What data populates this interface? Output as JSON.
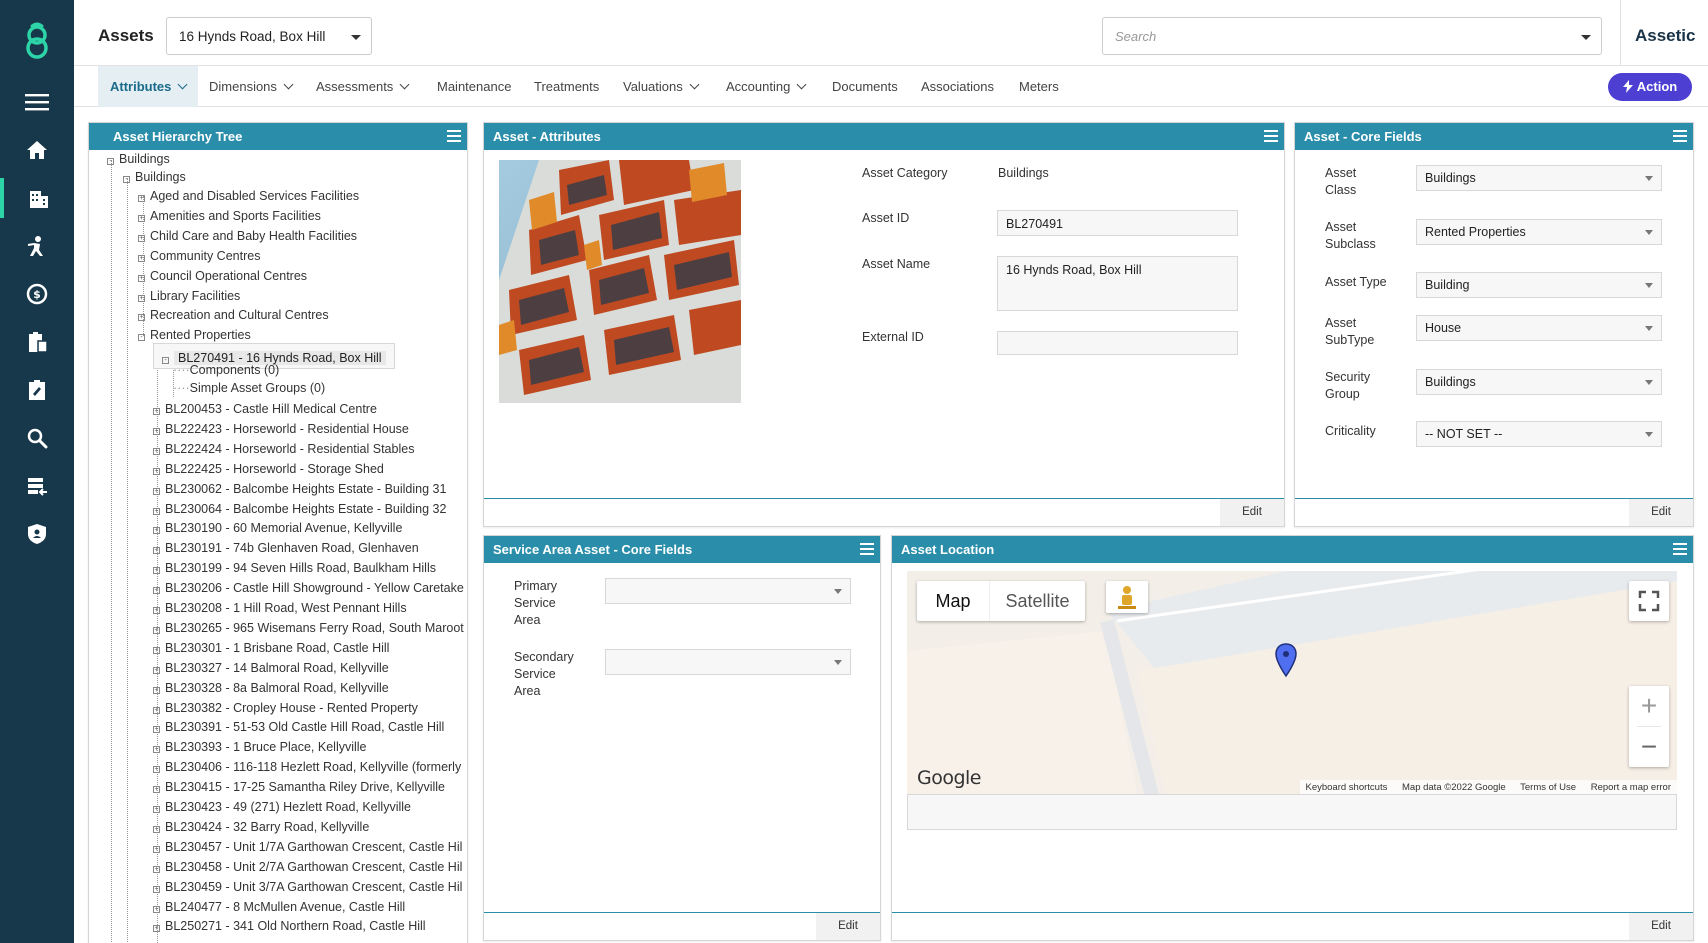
{
  "header": {
    "title": "Assets",
    "asset_select": "16 Hynds Road, Box Hill",
    "search_placeholder": "Search",
    "brand": "Assetic",
    "action_label": "Action"
  },
  "tabs": [
    {
      "label": "Attributes",
      "dropdown": true
    },
    {
      "label": "Dimensions",
      "dropdown": true
    },
    {
      "label": "Assessments",
      "dropdown": true
    },
    {
      "label": "Maintenance",
      "dropdown": false
    },
    {
      "label": "Treatments",
      "dropdown": false
    },
    {
      "label": "Valuations",
      "dropdown": true
    },
    {
      "label": "Accounting",
      "dropdown": true
    },
    {
      "label": "Documents",
      "dropdown": false
    },
    {
      "label": "Associations",
      "dropdown": false
    },
    {
      "label": "Meters",
      "dropdown": false
    }
  ],
  "sidebar_icons": [
    "menu-icon",
    "home-icon",
    "buildings-icon",
    "worker-icon",
    "finance-icon",
    "clipboard-icon",
    "assessment-icon",
    "search-icon",
    "data-import-icon",
    "security-icon"
  ],
  "tree_panel": {
    "title": "Asset Hierarchy Tree",
    "root": "Buildings",
    "level1": "Buildings",
    "categories": [
      "Aged and Disabled Services Facilities",
      "Amenities and Sports Facilities",
      "Child Care and Baby Health Facilities",
      "Community Centres",
      "Council Operational Centres",
      "Library Facilities",
      "Recreation and Cultural Centres",
      "Rented Properties"
    ],
    "selected": "BL270491 - 16 Hynds Road, Box Hill",
    "selected_children": [
      "Components (0)",
      "Simple Asset Groups (0)"
    ],
    "siblings": [
      "BL200453 - Castle Hill Medical Centre",
      "BL222423 - Horseworld - Residential House",
      "BL222424 - Horseworld - Residential Stables",
      "BL222425 - Horseworld - Storage Shed",
      "BL230062 - Balcombe Heights Estate - Building 31",
      "BL230064 - Balcombe Heights Estate - Building 32",
      "BL230190 - 60 Memorial Avenue, Kellyville",
      "BL230191 - 74b Glenhaven Road, Glenhaven",
      "BL230199 - 94 Seven Hills Road, Baulkham Hills",
      "BL230206 - Castle Hill Showground - Yellow Caretake",
      "BL230208 - 1 Hill Road, West Pennant Hills",
      "BL230265 - 965 Wisemans Ferry Road, South Maroot",
      "BL230301 - 1 Brisbane Road, Castle Hill",
      "BL230327 - 14 Balmoral Road, Kellyville",
      "BL230328 - 8a Balmoral Road, Kellyville",
      "BL230382 - Cropley House - Rented Property",
      "BL230391 - 51-53 Old Castle Hill Road, Castle Hill",
      "BL230393 - 1 Bruce Place, Kellyville",
      "BL230406 - 116-118 Hezlett Road, Kellyville (formerly",
      "BL230415 - 17-25 Samantha Riley Drive, Kellyville",
      "BL230423 - 49 (271) Hezlett Road, Kellyville",
      "BL230424 - 32 Barry Road, Kellyville",
      "BL230457 - Unit 1/7A Garthowan Crescent, Castle Hil",
      "BL230458 - Unit 2/7A Garthowan Crescent, Castle Hil",
      "BL230459 - Unit 3/7A Garthowan Crescent, Castle Hil",
      "BL240477 - 8 McMullen Avenue, Castle Hill",
      "BL250271 - 341 Old Northern Road, Castle Hill"
    ]
  },
  "attributes_panel": {
    "title": "Asset - Attributes",
    "fields": {
      "category_label": "Asset Category",
      "category_value": "Buildings",
      "id_label": "Asset ID",
      "id_value": "BL270491",
      "name_label": "Asset Name",
      "name_value": "16 Hynds Road, Box Hill",
      "external_label": "External ID",
      "external_value": ""
    },
    "edit_label": "Edit"
  },
  "core_panel": {
    "title": "Asset - Core Fields",
    "rows": [
      {
        "label1": "Asset",
        "label2": "Class",
        "value": "Buildings"
      },
      {
        "label1": "Asset",
        "label2": "Subclass",
        "value": "Rented Properties"
      },
      {
        "label1": "Asset Type",
        "label2": "",
        "value": "Building"
      },
      {
        "label1": "Asset",
        "label2": "SubType",
        "value": "House"
      },
      {
        "label1": "Security",
        "label2": "Group",
        "value": "Buildings"
      },
      {
        "label1": "Criticality",
        "label2": "",
        "value": "-- NOT SET --"
      }
    ],
    "edit_label": "Edit"
  },
  "service_panel": {
    "title": "Service Area Asset - Core Fields",
    "primary": [
      "Primary",
      "Service",
      "Area"
    ],
    "secondary": [
      "Secondary",
      "Service",
      "Area"
    ],
    "primary_value": "",
    "secondary_value": "",
    "edit_label": "Edit"
  },
  "location_panel": {
    "title": "Asset Location",
    "map_tab": "Map",
    "satellite_tab": "Satellite",
    "google": "Google",
    "footer_links": [
      "Keyboard shortcuts",
      "Map data ©2022 Google",
      "Terms of Use",
      "Report a map error"
    ],
    "zoom_in": "+",
    "zoom_out": "−",
    "edit_label": "Edit"
  },
  "colors": {
    "rail": "#17374a",
    "panel_header": "#2a8eaa",
    "action": "#4c3fd1",
    "logo": "#2dd4a7"
  }
}
